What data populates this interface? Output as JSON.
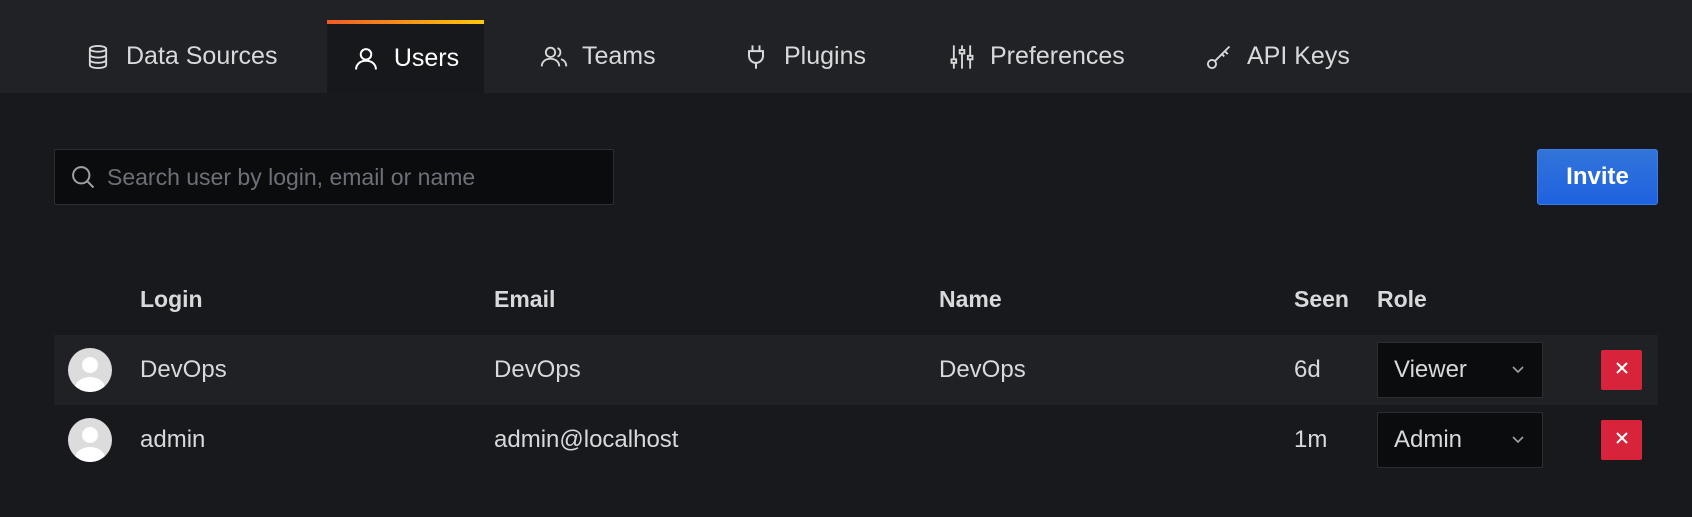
{
  "tabs": [
    {
      "label": "Data Sources",
      "icon": "database-icon"
    },
    {
      "label": "Users",
      "icon": "user-icon"
    },
    {
      "label": "Teams",
      "icon": "users-icon"
    },
    {
      "label": "Plugins",
      "icon": "plug-icon"
    },
    {
      "label": "Preferences",
      "icon": "sliders-icon"
    },
    {
      "label": "API Keys",
      "icon": "key-icon"
    }
  ],
  "active_tab": "Users",
  "search": {
    "placeholder": "Search user by login, email or name",
    "value": ""
  },
  "invite_label": "Invite",
  "table": {
    "headers": {
      "login": "Login",
      "email": "Email",
      "name": "Name",
      "seen": "Seen",
      "role": "Role"
    },
    "rows": [
      {
        "login": "DevOps",
        "email": "DevOps",
        "name": "DevOps",
        "seen": "6d",
        "role": "Viewer"
      },
      {
        "login": "admin",
        "email": "admin@localhost",
        "name": "",
        "seen": "1m",
        "role": "Admin"
      }
    ]
  },
  "colors": {
    "accent": "#1f62e0",
    "danger": "#d7243a",
    "tab_gradient_start": "#f05a28",
    "tab_gradient_end": "#fbca0a"
  }
}
